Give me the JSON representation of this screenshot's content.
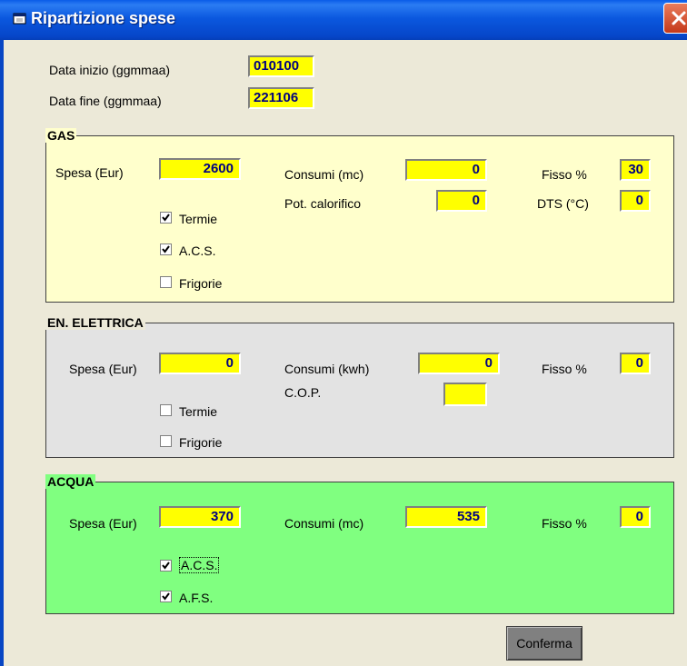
{
  "window": {
    "title": "Ripartizione spese"
  },
  "dates": {
    "start_label": "Data inizio  (ggmmaa)",
    "start_value": "010100",
    "end_label": "Data fine   (ggmmaa)",
    "end_value": "221106"
  },
  "gas": {
    "title": "GAS",
    "spesa_label": "Spesa (Eur)",
    "spesa_value": "2600",
    "consumi_label": "Consumi  (mc)",
    "consumi_value": "0",
    "fisso_label": "Fisso  %",
    "fisso_value": "30",
    "pot_label": "Pot. calorifico",
    "pot_value": "0",
    "dts_label": "DTS (°C)",
    "dts_value": "0",
    "checkboxes": [
      {
        "label": "Termie",
        "checked": true
      },
      {
        "label": "A.C.S.",
        "checked": true
      },
      {
        "label": "Frigorie",
        "checked": false
      }
    ]
  },
  "elettrica": {
    "title": "EN. ELETTRICA",
    "spesa_label": "Spesa (Eur)",
    "spesa_value": "0",
    "consumi_label": "Consumi  (kwh)",
    "consumi_value": "0",
    "fisso_label": "Fisso %",
    "fisso_value": "0",
    "cop_label": "C.O.P.",
    "cop_value": "",
    "checkboxes": [
      {
        "label": "Termie",
        "checked": false
      },
      {
        "label": "Frigorie",
        "checked": false
      }
    ]
  },
  "acqua": {
    "title": "ACQUA",
    "spesa_label": "Spesa (Eur)",
    "spesa_value": "370",
    "consumi_label": "Consumi  (mc)",
    "consumi_value": "535",
    "fisso_label": "Fisso %",
    "fisso_value": "0",
    "checkboxes": [
      {
        "label": "A.C.S.",
        "checked": true
      },
      {
        "label": "A.F.S.",
        "checked": true
      }
    ]
  },
  "confirm_label": "Conferma",
  "colors": {
    "gas_bg": "#ffffcc",
    "elettrica_bg": "#e3e3e3",
    "acqua_bg": "#80ff80",
    "field_bg": "#ffff00",
    "field_text": "#000080"
  }
}
